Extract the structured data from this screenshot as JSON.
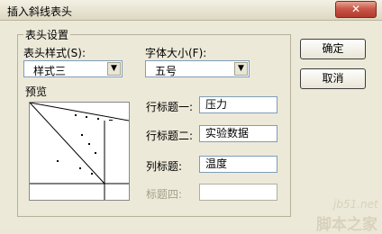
{
  "window": {
    "title": "插入斜线表头",
    "close_glyph": "✕"
  },
  "group": {
    "legend": "表头设置"
  },
  "style_field": {
    "label": "表头样式(S):",
    "value": "样式三",
    "arrow": "▼"
  },
  "font_field": {
    "label": "字体大小(F):",
    "value": "五号",
    "arrow": "▼"
  },
  "preview": {
    "label": "预览"
  },
  "row_title_1": {
    "label": "行标题一:",
    "value": "压力"
  },
  "row_title_2": {
    "label": "行标题二:",
    "value": "实验数据"
  },
  "col_title": {
    "label": "列标题:",
    "value": "温度"
  },
  "title_4": {
    "label": "标题四:",
    "value": ""
  },
  "buttons": {
    "ok": "确定",
    "cancel": "取消"
  },
  "watermark": {
    "url": "jb51.net",
    "name": "脚本之家"
  },
  "colors": {
    "dialog_bg": "#ece9d8",
    "close": "#c9584a"
  }
}
